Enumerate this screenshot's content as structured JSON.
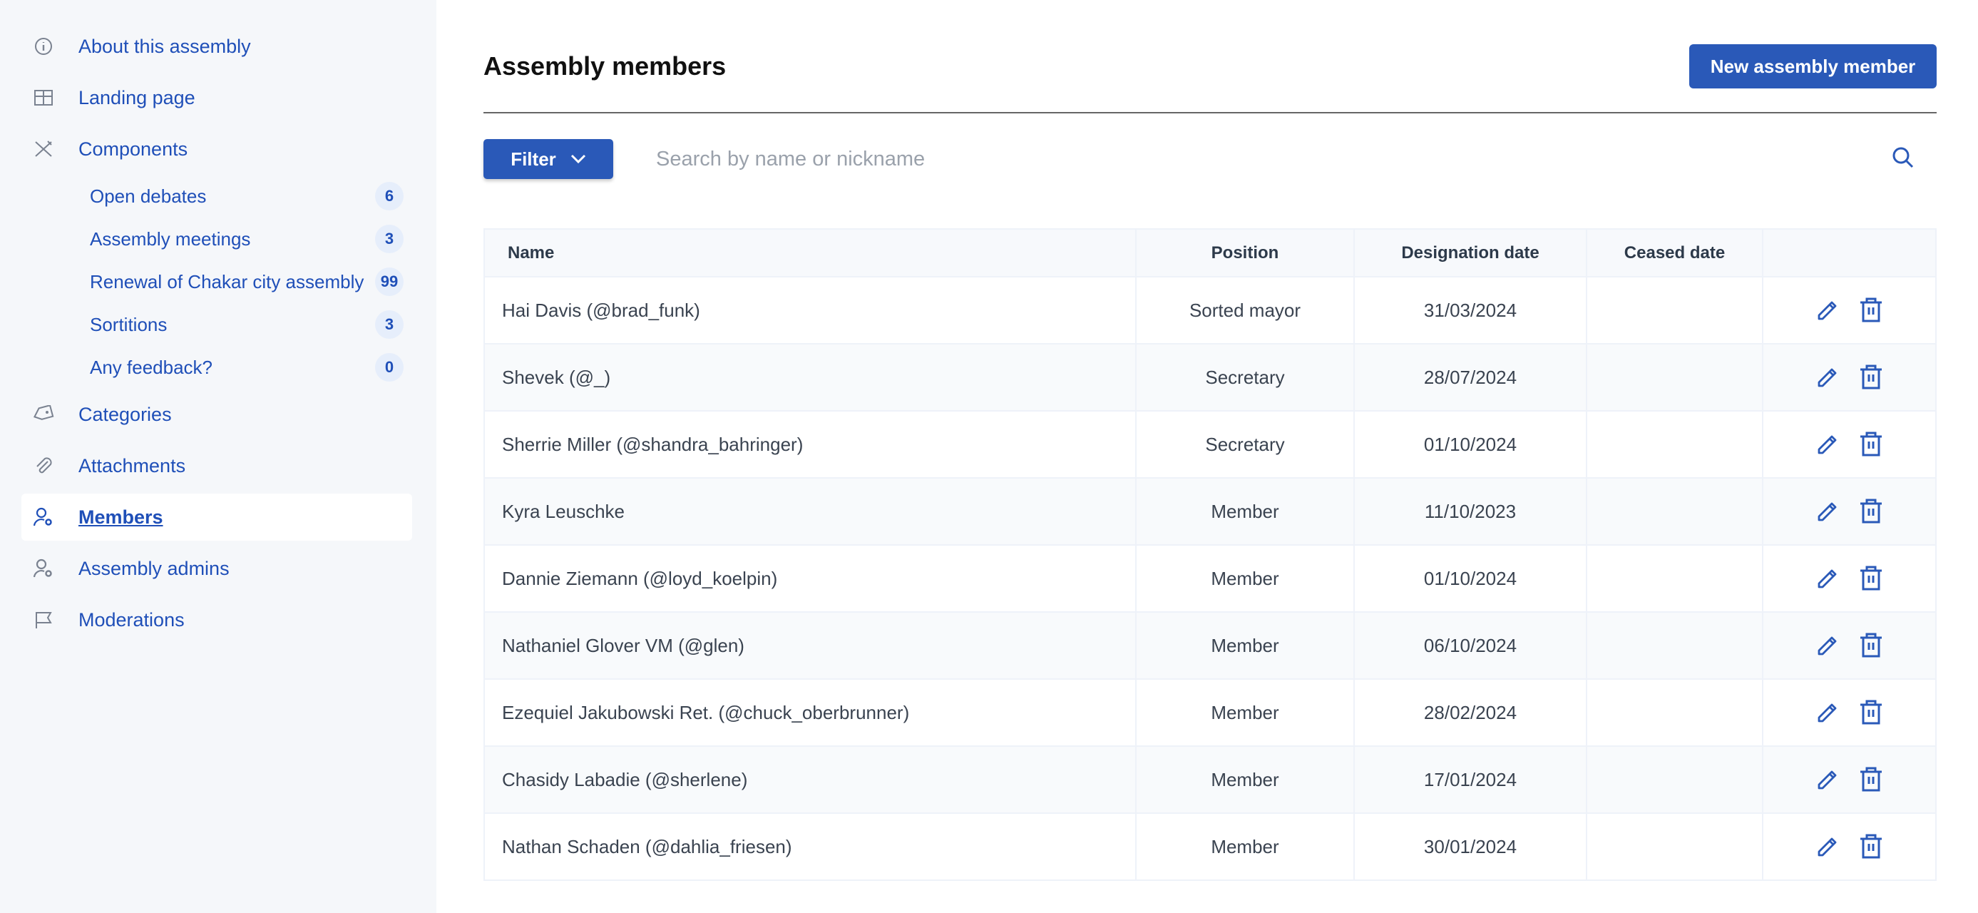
{
  "sidebar": {
    "items": [
      {
        "label": "About this assembly",
        "icon": "info-icon"
      },
      {
        "label": "Landing page",
        "icon": "layout-icon"
      },
      {
        "label": "Components",
        "icon": "tools-icon"
      },
      {
        "label": "Categories",
        "icon": "tag-icon"
      },
      {
        "label": "Attachments",
        "icon": "paperclip-icon"
      },
      {
        "label": "Members",
        "icon": "user-settings-icon",
        "active": true
      },
      {
        "label": "Assembly admins",
        "icon": "user-settings-icon"
      },
      {
        "label": "Moderations",
        "icon": "flag-icon"
      }
    ],
    "components": [
      {
        "label": "Open debates",
        "count": "6"
      },
      {
        "label": "Assembly meetings",
        "count": "3"
      },
      {
        "label": "Renewal of Chakar city assembly",
        "count": "99"
      },
      {
        "label": "Sortitions",
        "count": "3"
      },
      {
        "label": "Any feedback?",
        "count": "0"
      }
    ]
  },
  "main": {
    "title": "Assembly members",
    "new_button": "New assembly member",
    "filter_label": "Filter",
    "search_placeholder": "Search by name or nickname",
    "columns": [
      "Name",
      "Position",
      "Designation date",
      "Ceased date",
      ""
    ],
    "rows": [
      {
        "name": "Hai Davis (@brad_funk)",
        "position": "Sorted mayor",
        "designation": "31/03/2024",
        "ceased": ""
      },
      {
        "name": "Shevek (@_)",
        "position": "Secretary",
        "designation": "28/07/2024",
        "ceased": ""
      },
      {
        "name": "Sherrie Miller (@shandra_bahringer)",
        "position": "Secretary",
        "designation": "01/10/2024",
        "ceased": ""
      },
      {
        "name": "Kyra Leuschke",
        "position": "Member",
        "designation": "11/10/2023",
        "ceased": ""
      },
      {
        "name": "Dannie Ziemann (@loyd_koelpin)",
        "position": "Member",
        "designation": "01/10/2024",
        "ceased": ""
      },
      {
        "name": "Nathaniel Glover VM (@glen)",
        "position": "Member",
        "designation": "06/10/2024",
        "ceased": ""
      },
      {
        "name": "Ezequiel Jakubowski Ret. (@chuck_oberbrunner)",
        "position": "Member",
        "designation": "28/02/2024",
        "ceased": ""
      },
      {
        "name": "Chasidy Labadie (@sherlene)",
        "position": "Member",
        "designation": "17/01/2024",
        "ceased": ""
      },
      {
        "name": "Nathan Schaden (@dahlia_friesen)",
        "position": "Member",
        "designation": "30/01/2024",
        "ceased": ""
      }
    ]
  },
  "colors": {
    "accent": "#2a59b8",
    "link": "#1f4fb8",
    "sidebar_bg": "#f5f7fa"
  }
}
